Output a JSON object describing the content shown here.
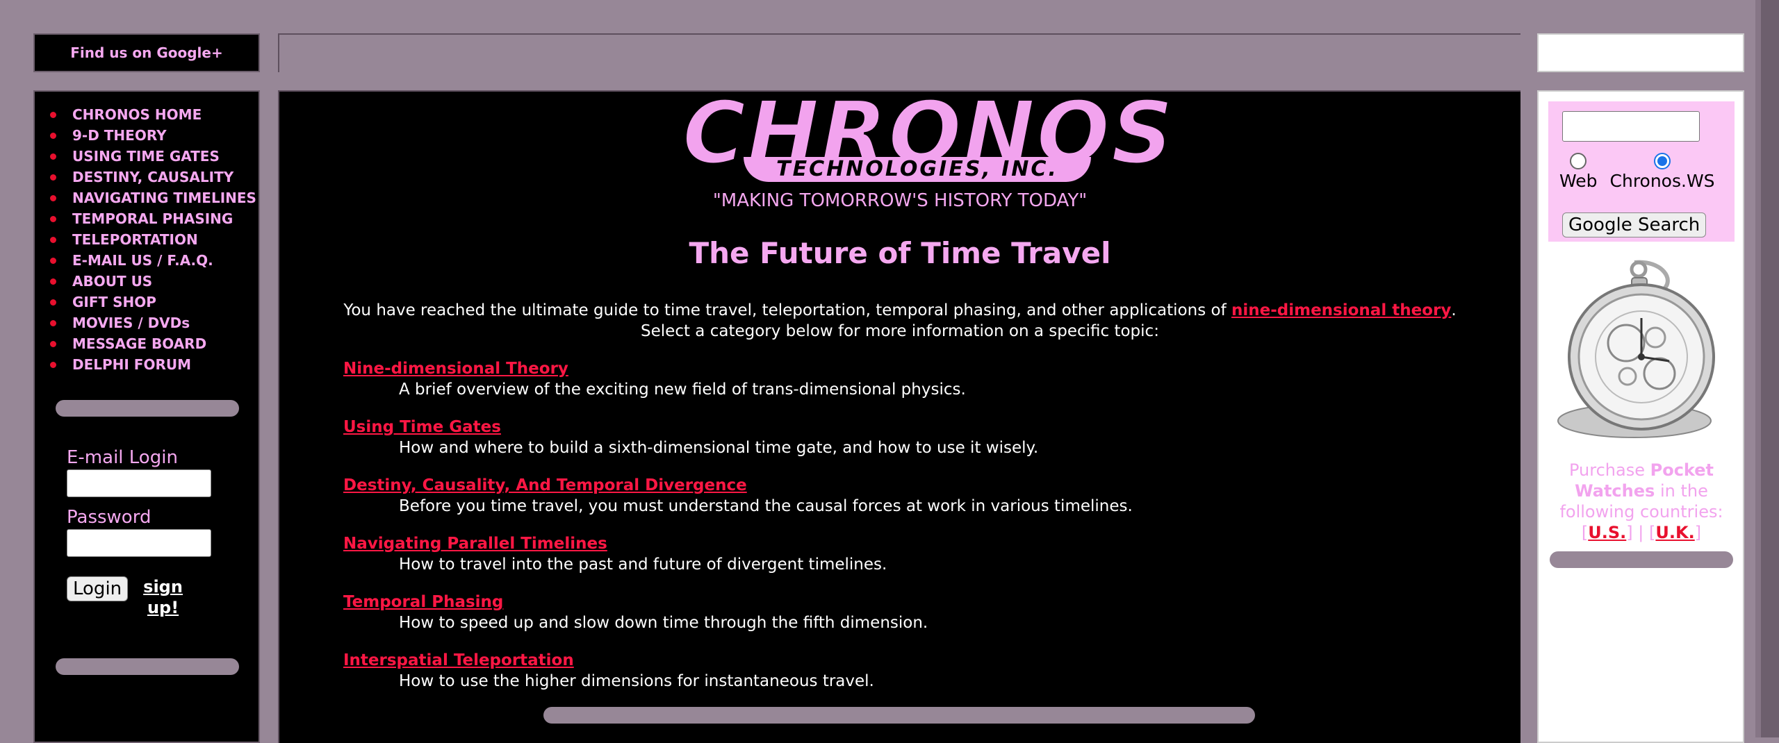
{
  "header": {
    "google_plus": "Find us on Google+"
  },
  "nav": {
    "items": [
      "CHRONOS HOME",
      "9-D THEORY",
      "USING TIME GATES",
      "DESTINY, CAUSALITY",
      "NAVIGATING TIMELINES",
      "TEMPORAL PHASING",
      "TELEPORTATION",
      "E-MAIL US / F.A.Q.",
      "ABOUT US",
      "GIFT SHOP",
      "MOVIES / DVDs",
      "MESSAGE BOARD",
      "DELPHI FORUM"
    ]
  },
  "login": {
    "email_label": "E-mail Login",
    "password_label": "Password",
    "button": "Login",
    "signup_line1": "sign",
    "signup_line2": "up!"
  },
  "logo": {
    "main": "CHRONOS",
    "sub": "TECHNOLOGIES, INC."
  },
  "main": {
    "slogan": "\"MAKING TOMORROW'S HISTORY TODAY\"",
    "heading": "The Future of Time Travel",
    "intro_prefix": "You have reached the ultimate guide to time travel, teleportation, temporal phasing, and other applications of ",
    "intro_link": "nine-dimensional theory",
    "intro_suffix": ".",
    "intro_line2": "Select a category below for more information on a specific topic:",
    "topics": [
      {
        "title": "Nine-dimensional Theory",
        "desc": "A brief overview of the exciting new field of trans-dimensional physics."
      },
      {
        "title": "Using Time Gates",
        "desc": "How and where to build a sixth-dimensional time gate, and how to use it wisely."
      },
      {
        "title": "Destiny, Causality, And Temporal Divergence",
        "desc": "Before you time travel, you must understand the causal forces at work in various timelines."
      },
      {
        "title": "Navigating Parallel Timelines",
        "desc": "How to travel into the past and future of divergent timelines."
      },
      {
        "title": "Temporal Phasing",
        "desc": "How to speed up and slow down time through the fifth dimension."
      },
      {
        "title": "Interspatial Teleportation",
        "desc": "How to use the higher dimensions for instantaneous travel."
      }
    ]
  },
  "search": {
    "radio_web": "Web",
    "radio_site": "Chronos.WS",
    "selected": "Chronos.WS",
    "button": "Google Search"
  },
  "promo": {
    "purchase": "Purchase ",
    "product": "Pocket Watches",
    "rest": " in the following countries:",
    "us": "U.S.",
    "uk": "U.K.",
    "sep": "|",
    "open_bracket": "[",
    "close_bracket": "]"
  }
}
